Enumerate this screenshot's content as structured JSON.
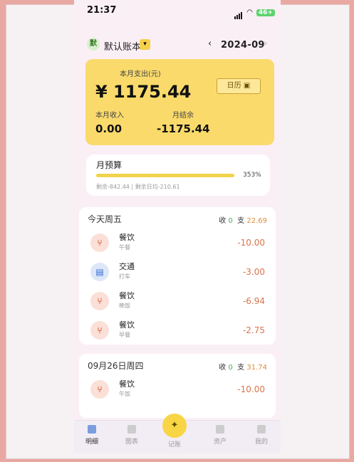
{
  "status": {
    "time": "21:37",
    "battery": "46+"
  },
  "header": {
    "book_badge": "默",
    "book_name": "默认账本",
    "month": "2024-09",
    "prev_icon": "chevron-left-icon",
    "next_icon": "chevron-right-icon"
  },
  "summary": {
    "expense_label": "本月支出(元)",
    "expense_amount": "¥ 1175.44",
    "calendar_button": "日历",
    "income_label": "本月收入",
    "income_value": "0.00",
    "balance_label": "月结余",
    "balance_value": "-1175.44"
  },
  "budget": {
    "title": "月预算",
    "percent_text": "353%",
    "progress": 1.0,
    "detail": "剩余-842.44 | 剩余日均-210.61"
  },
  "days": [
    {
      "title": "今天周五",
      "income_label": "收",
      "income": "0",
      "expense_label": "支",
      "expense": "22.69",
      "items": [
        {
          "category": "餐饮",
          "note": "午餐",
          "amount": "-10.00",
          "icon": "utensils-icon"
        },
        {
          "category": "交通",
          "note": "打车",
          "amount": "-3.00",
          "icon": "bus-icon"
        },
        {
          "category": "餐饮",
          "note": "晚饭",
          "amount": "-6.94",
          "icon": "utensils-icon"
        },
        {
          "category": "餐饮",
          "note": "早餐",
          "amount": "-2.75",
          "icon": "utensils-icon"
        }
      ]
    },
    {
      "title": "09月26日周四",
      "income_label": "收",
      "income": "0",
      "expense_label": "支",
      "expense": "31.74",
      "items": [
        {
          "category": "餐饮",
          "note": "午饭",
          "amount": "-10.00",
          "icon": "utensils-icon"
        }
      ]
    }
  ],
  "tabs": [
    "明细",
    "图表",
    "记账",
    "资产",
    "我的"
  ],
  "colors": {
    "accent": "#fada6b",
    "income": "#4cae5a",
    "expense": "#e08a3c"
  }
}
